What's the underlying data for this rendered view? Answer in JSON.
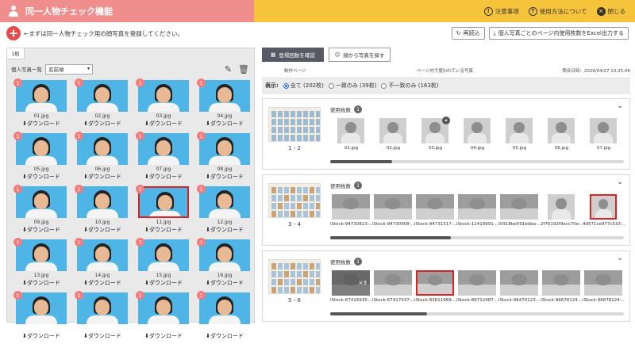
{
  "header": {
    "title": "同一人物チェック機能",
    "links": [
      {
        "icon": "exclamation-icon",
        "label": "注意事項"
      },
      {
        "icon": "question-icon",
        "label": "使用方法について"
      },
      {
        "icon": "close-icon",
        "label": "閉じる"
      }
    ]
  },
  "instruction": "←まずは同一人物チェック用の顔写真を登録してください。",
  "toolbar": {
    "reload_label": "再読込",
    "export_label": "個人写真ごとのページ内使用枚数をExcel出力する"
  },
  "left": {
    "tab_label": "1組",
    "list_label": "個人写真一覧",
    "sort_value": "名前順",
    "download_label": "ダウンロード",
    "photos": [
      {
        "name": "01.jpg",
        "badge": "1"
      },
      {
        "name": "02.jpg",
        "badge": "1"
      },
      {
        "name": "03.jpg",
        "badge": "1"
      },
      {
        "name": "04.jpg",
        "badge": "1"
      },
      {
        "name": "05.jpg",
        "badge": "1"
      },
      {
        "name": "06.jpg",
        "badge": "1"
      },
      {
        "name": "07.jpg",
        "badge": "1"
      },
      {
        "name": "08.jpg",
        "badge": "1"
      },
      {
        "name": "09.jpg",
        "badge": "1"
      },
      {
        "name": "10.jpg",
        "badge": "1"
      },
      {
        "name": "11.jpg",
        "badge": "0"
      },
      {
        "name": "12.jpg",
        "badge": "1"
      },
      {
        "name": "13.jpg",
        "badge": "1"
      },
      {
        "name": "14.jpg",
        "badge": "1"
      },
      {
        "name": "15.jpg",
        "badge": "7"
      },
      {
        "name": "16.jpg",
        "badge": "1"
      },
      {
        "name": "",
        "badge": "1"
      },
      {
        "name": "",
        "badge": "1"
      },
      {
        "name": "",
        "badge": "1"
      },
      {
        "name": "",
        "badge": "1"
      }
    ]
  },
  "right": {
    "tabs": [
      {
        "label": "登場回数を確認",
        "icon": "grid-icon"
      },
      {
        "label": "顔から写真を探す",
        "icon": "face-icon"
      }
    ],
    "info": {
      "page_col": "制作ページ",
      "photos_col": "ページ内で使われている写真",
      "timestamp": "照合日時：2026/04/27 13:25:06"
    },
    "filter": {
      "label": "表示:",
      "options": [
        "全て (202枚)",
        "一致のみ (39枚)",
        "不一致のみ (163枚)"
      ]
    },
    "use_count_label": "使用枚数",
    "sections": [
      {
        "page": "1 - 2",
        "count": "1",
        "scroll": 0.21,
        "thumbs": [
          {
            "name": "01.jpg",
            "style": "portrait"
          },
          {
            "name": "02.jpg",
            "style": "portrait"
          },
          {
            "name": "03.jpg",
            "style": "portrait",
            "pin": true
          },
          {
            "name": "04.jpg",
            "style": "portrait"
          },
          {
            "name": "05.jpg",
            "style": "portrait"
          },
          {
            "name": "06.jpg",
            "style": "portrait"
          },
          {
            "name": "07.jpg",
            "style": "portrait"
          }
        ]
      },
      {
        "page": "3 - 4",
        "count": "1",
        "scroll": 0.41,
        "thumbs": [
          {
            "name": "iStock-94730813-...",
            "style": "scene"
          },
          {
            "name": "iStock-94730908-...",
            "style": "scene"
          },
          {
            "name": "iStock-94731517-...",
            "style": "scene"
          },
          {
            "name": "iStock-11419991-...",
            "style": "scene"
          },
          {
            "name": "0f318be591bdba-...",
            "style": "scene"
          },
          {
            "name": "2f76192f9ecc70e-...",
            "style": "portrait"
          },
          {
            "name": "4d571ce977c533-...",
            "style": "portrait",
            "red": true
          }
        ]
      },
      {
        "page": "5 - 6",
        "count": "1",
        "scroll": 0.33,
        "thumbs": [
          {
            "name": "iStock-67416935-...",
            "style": "scene",
            "overlay": "×3"
          },
          {
            "name": "iStock-67417037-...",
            "style": "scene"
          },
          {
            "name": "iStock-83811669-...",
            "style": "scene",
            "red": true
          },
          {
            "name": "iStock-86712487-...",
            "style": "scene"
          },
          {
            "name": "iStock-96470123-...",
            "style": "scene"
          },
          {
            "name": "iStock-96678124-...",
            "style": "scene"
          },
          {
            "name": "iStock-96678124-...",
            "style": "scene"
          }
        ]
      }
    ]
  },
  "colors": {
    "header_left": "#f08d8d",
    "header_right": "#f6c43b",
    "add_button": "#e84a4a",
    "photo_bg": "#4fb4e6",
    "badge": "#f47c7c",
    "tab_active": "#555a64",
    "highlight": "#dd2222"
  }
}
